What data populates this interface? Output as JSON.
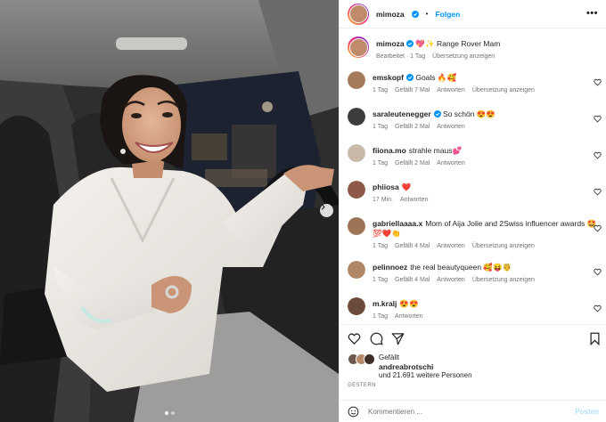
{
  "post": {
    "username": "mimoza",
    "follow_label": "Folgen",
    "more_label": "•••",
    "caption_emoji": "💖✨",
    "caption_text": "Range Rover Mam",
    "caption_meta": {
      "edited": "Bearbeitet",
      "time": "1 Tag",
      "translate": "Übersetzung anzeigen"
    }
  },
  "comments": [
    {
      "user": "emskopf",
      "verified": true,
      "text": "Goals 🔥🥰",
      "time": "1 Tag",
      "likes": "Gefällt 7 Mal",
      "reply": "Antworten",
      "translate": "Übersetzung anzeigen",
      "avatar_color": "#a57b5c"
    },
    {
      "user": "saraleutenegger",
      "verified": true,
      "text": "So schön 😍😍",
      "time": "1 Tag",
      "likes": "Gefällt 2 Mal",
      "reply": "Antworten",
      "translate": "",
      "avatar_color": "#3c3c3c"
    },
    {
      "user": "fiiona.mo",
      "verified": false,
      "text": "strahle maus💕",
      "time": "1 Tag",
      "likes": "Gefällt 2 Mal",
      "reply": "Antworten",
      "translate": "",
      "avatar_color": "#c9b9a8"
    },
    {
      "user": "phiiosa",
      "verified": false,
      "text": "❤️",
      "time": "17 Min.",
      "likes": "",
      "reply": "Antworten",
      "translate": "",
      "avatar_color": "#8c5a46"
    },
    {
      "user": "gabriellaaaa.x",
      "verified": false,
      "text": "Mom of Aija Jolie and 2Swiss influencer awards 🤩💯❤️👏",
      "time": "1 Tag",
      "likes": "Gefällt 4 Mal",
      "reply": "Antworten",
      "translate": "Übersetzung anzeigen",
      "avatar_color": "#9d7556"
    },
    {
      "user": "pelinnoez",
      "verified": false,
      "text": "the real beautyqueen 🥰😝🤴",
      "time": "1 Tag",
      "likes": "Gefällt 4 Mal",
      "reply": "Antworten",
      "translate": "Übersetzung anzeigen",
      "avatar_color": "#b08868"
    },
    {
      "user": "m.kralj",
      "verified": false,
      "text": "😍😍",
      "time": "1 Tag",
      "likes": "",
      "reply": "Antworten",
      "translate": "",
      "avatar_color": "#6b4b3a"
    }
  ],
  "likes": {
    "label": "Gefällt",
    "first_user": "andreabrotschi",
    "others": "und 21.691 weitere Personen"
  },
  "date_label": "GESTERN",
  "add_comment": {
    "placeholder": "Kommentieren ...",
    "post_label": "Posten"
  },
  "colors": {
    "accent": "#0095f6",
    "verified": "#0095f6",
    "muted": "#737373"
  },
  "icons": [
    "heart-icon",
    "comment-icon",
    "share-icon",
    "bookmark-icon",
    "emoji-icon",
    "verified-icon",
    "chevron-right-icon"
  ]
}
